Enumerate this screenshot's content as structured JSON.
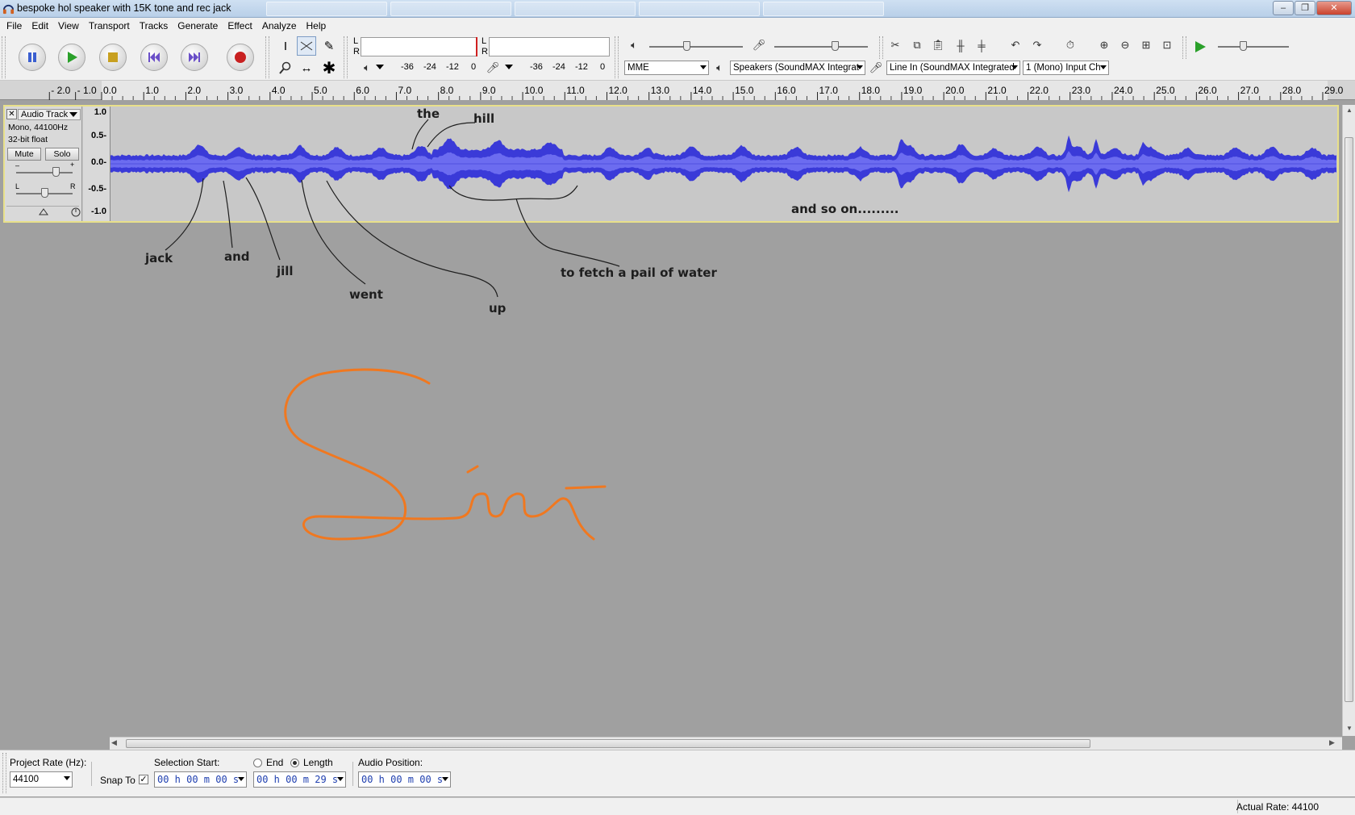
{
  "window": {
    "title": "bespoke hol speaker with 15K tone and rec jack",
    "controls": [
      "–",
      "❐",
      "✕"
    ]
  },
  "menu": [
    "File",
    "Edit",
    "View",
    "Transport",
    "Tracks",
    "Generate",
    "Effect",
    "Analyze",
    "Help"
  ],
  "transport": {
    "buttons": [
      "pause",
      "play",
      "stop",
      "skip-to-start",
      "skip-to-end",
      "record"
    ]
  },
  "tools": [
    "selection",
    "envelope",
    "draw",
    "zoom",
    "time-shift",
    "multi"
  ],
  "meters": {
    "play_channels": [
      "L",
      "R"
    ],
    "rec_channels": [
      "L",
      "R"
    ],
    "play_scale": [
      "-36",
      "-24",
      "-12",
      "0"
    ],
    "rec_scale": [
      "-36",
      "-24",
      "-12",
      "0"
    ]
  },
  "mixer": {
    "output_volume_fraction": 0.4,
    "input_volume_fraction": 0.65,
    "play_speed_fraction": 0.35
  },
  "devices": {
    "host": "MME",
    "output": "Speakers (SoundMAX Integrat",
    "input": "Line In (SoundMAX Integrated",
    "channels": "1 (Mono) Input Ch"
  },
  "ruler": {
    "labels": [
      "- 2.0",
      "- 1.0",
      "0.0",
      "1.0",
      "2.0",
      "3.0",
      "4.0",
      "5.0",
      "6.0",
      "7.0",
      "8.0",
      "9.0",
      "10.0",
      "11.0",
      "12.0",
      "13.0",
      "14.0",
      "15.0",
      "16.0",
      "17.0",
      "18.0",
      "19.0",
      "20.0",
      "21.0",
      "22.0",
      "23.0",
      "24.0",
      "25.0",
      "26.0",
      "27.0",
      "28.0",
      "29.0"
    ],
    "start_seconds": -2.0,
    "end_seconds": 29.0
  },
  "track": {
    "name": "Audio Track",
    "format": "Mono, 44100Hz",
    "sample_format": "32-bit float",
    "mute_label": "Mute",
    "solo_label": "Solo",
    "gain_fraction": 0.7,
    "pan_fraction": 0.5,
    "vscale": [
      "1.0",
      "0.5-",
      "0.0-",
      "-0.5-",
      "-1.0"
    ],
    "wave_color": "#3a3ad8",
    "rms_color": "#6c6cf0"
  },
  "annotations": {
    "the": "the",
    "hill": "hill",
    "jack": "jack",
    "and": "and",
    "jill": "jill",
    "went": "went",
    "up": "up",
    "fetch": "to fetch a pail of water",
    "so_on": "and so on.........",
    "signature_color": "#f07820",
    "signature_text": "Siri"
  },
  "selection": {
    "project_rate_label": "Project Rate (Hz):",
    "project_rate": "44100",
    "snap_label": "Snap To",
    "snap_checked": "✓",
    "start_label": "Selection Start:",
    "end_label": "End",
    "length_label": "Length",
    "position_label": "Audio Position:",
    "start_value": "00 h 00 m 00 s",
    "length_value": "00 h 00 m 29 s",
    "position_value": "00 h 00 m 00 s"
  },
  "status": {
    "actual_rate": "Actual Rate: 44100"
  }
}
